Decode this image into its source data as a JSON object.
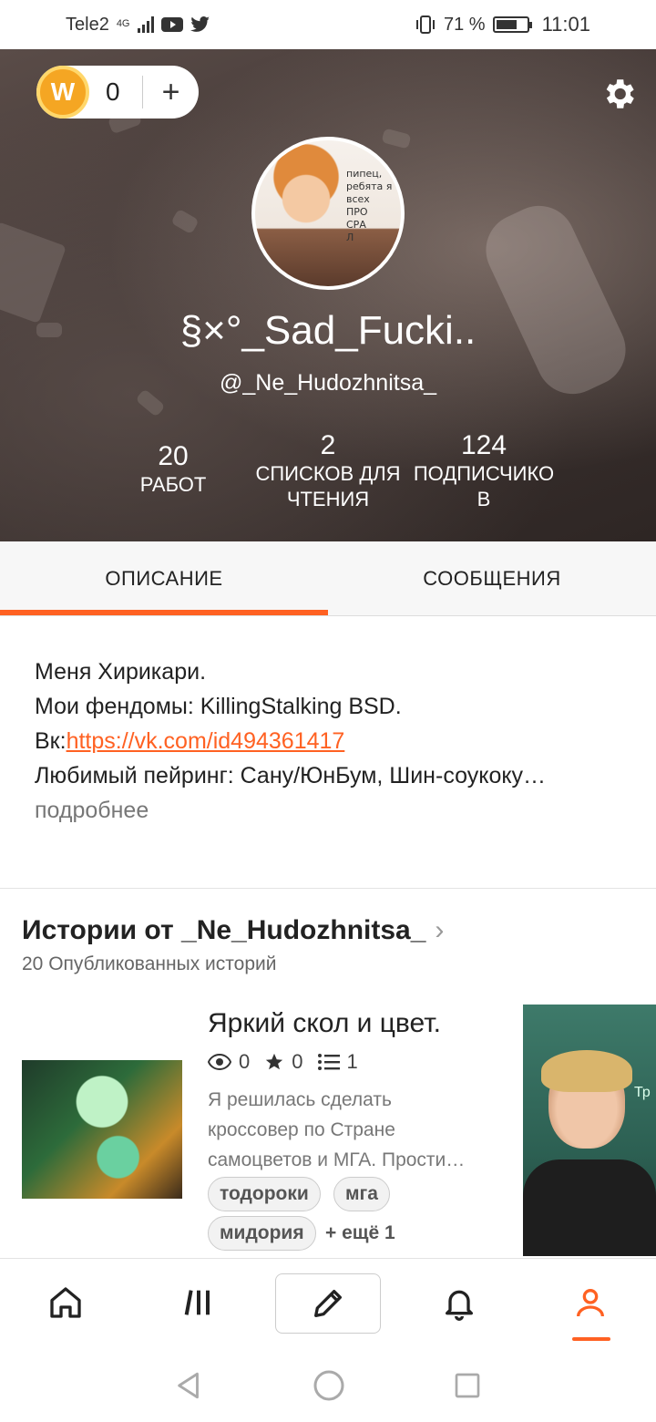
{
  "status_bar": {
    "carrier": "Tele2",
    "network": "4G",
    "battery_percent": "71 %",
    "time": "11:01"
  },
  "header": {
    "coins": "0",
    "add_symbol": "+",
    "display_name": "§×°_Sad_Fucki..",
    "username": "@_Ne_Hudozhnitsa_",
    "avatar_text": [
      "пипец,",
      "ребята я",
      "всех",
      "ПРО",
      "СРА",
      "Л"
    ],
    "stats": [
      {
        "value": "20",
        "label_lines": [
          "РАБОТ"
        ]
      },
      {
        "value": "2",
        "label_lines": [
          "СПИСКОВ ДЛЯ",
          "ЧТЕНИЯ"
        ]
      },
      {
        "value": "124",
        "label_lines": [
          "ПОДПИСЧИКО",
          "В"
        ]
      }
    ]
  },
  "tabs": [
    {
      "label": "ОПИСАНИЕ",
      "active": true
    },
    {
      "label": "СООБЩЕНИЯ",
      "active": false
    }
  ],
  "about": {
    "line1": "Меня Хирикари.",
    "line2": "Мои фендомы: KillingStalking BSD.",
    "line3_prefix": "Вк:",
    "line3_link": "https://vk.com/id494361417",
    "line4": "Любимый пейринг: Сану/ЮнБум, Шин-соукоку…",
    "more": "подробнее"
  },
  "stories": {
    "title": "Истории от _Ne_Hudozhnitsa_",
    "subtitle": "20 Опубликованных историй",
    "items": [
      {
        "title": "Яркий скол и цвет.",
        "views": "0",
        "votes": "0",
        "parts": "1",
        "description_lines": [
          "Я решилась сделать",
          "кроссовер по Стране",
          "самоцветов и МГА. Прости…"
        ],
        "tags": [
          "тодороки",
          "мга",
          "мидория"
        ],
        "more_tags": "+ ещё 1"
      }
    ]
  },
  "video_overlay": {
    "text": "Тр"
  },
  "bottom_nav": [
    "home-icon",
    "library-icon",
    "write-icon",
    "notifications-icon",
    "profile-icon"
  ],
  "colors": {
    "accent": "#ff6122"
  }
}
